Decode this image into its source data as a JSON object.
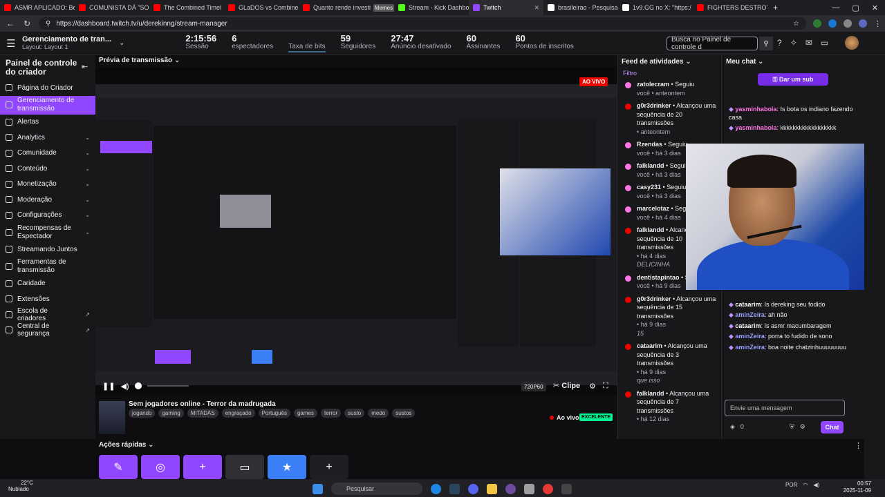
{
  "browser": {
    "tabs": [
      {
        "label": "ASMR APLICADO: Be",
        "color": "#ff0000"
      },
      {
        "label": "COMUNISTA DÁ \"SO",
        "color": "#ff0000"
      },
      {
        "label": "The Combined Timel",
        "color": "#ff0000"
      },
      {
        "label": "GLaDOS vs Combine",
        "color": "#ff0000"
      },
      {
        "label": "Quanto rende investi",
        "color": "#ff0000"
      },
      {
        "label": "Memes",
        "color": "#666666"
      },
      {
        "label": "Stream - Kick Dashbo",
        "color": "#53fc18"
      },
      {
        "label": "Twitch",
        "color": "#9146ff"
      },
      {
        "label": "brasileirao - Pesquisa",
        "color": "#ffffff"
      },
      {
        "label": "1v9.GG no X: \"https:/",
        "color": "#ffffff"
      },
      {
        "label": "FIGHTERS DESTROY C",
        "color": "#ff0000"
      }
    ],
    "url": "https://dashboard.twitch.tv/u/derekinng/stream-manager"
  },
  "topbar": {
    "context_title": "Gerenciamento de tran...",
    "context_sub": "Layout: Layout 1",
    "stats": [
      {
        "value": "2:15:56",
        "label": "Sessão"
      },
      {
        "value": "6",
        "label": "espectadores"
      },
      {
        "value": "",
        "label": "Taxa de bits"
      },
      {
        "value": "59",
        "label": "Seguidores"
      },
      {
        "value": "27:47",
        "label": "Anúncio desativado"
      },
      {
        "value": "60",
        "label": "Assinantes"
      },
      {
        "value": "60",
        "label": "Pontos de inscritos"
      }
    ],
    "search_placeholder": "Busca no Painel de controle d"
  },
  "sidebar": {
    "title": "Painel de controle do criador",
    "items": [
      {
        "label": "Página do Criador",
        "chevron": false
      },
      {
        "label": "Gerenciamento de transmissão",
        "chevron": false,
        "active": true
      },
      {
        "label": "Alertas",
        "chevron": false
      },
      {
        "label": "Analytics",
        "chevron": true
      },
      {
        "label": "Comunidade",
        "chevron": true
      },
      {
        "label": "Conteúdo",
        "chevron": true
      },
      {
        "label": "Monetização",
        "chevron": true
      },
      {
        "label": "Moderação",
        "chevron": true
      },
      {
        "label": "Configurações",
        "chevron": true
      },
      {
        "label": "Recompensas de Espectador",
        "chevron": true
      },
      {
        "label": "Streamando Juntos",
        "chevron": false
      },
      {
        "label": "Ferramentas de transmissão",
        "chevron": false
      },
      {
        "label": "Caridade",
        "chevron": false
      },
      {
        "label": "Extensões",
        "chevron": false
      },
      {
        "label": "Escola de criadores",
        "chevron": false
      },
      {
        "label": "Central de segurança",
        "chevron": false
      }
    ]
  },
  "preview": {
    "title": "Prévia de transmissão",
    "live_badge": "AO VIVO",
    "quality": "720P60",
    "clip": "Clipe"
  },
  "stream": {
    "title": "Sem jogadores online - Terror da madrugada",
    "tags": [
      "jogando",
      "gaming",
      "MITADAS",
      "engraçado",
      "Português",
      "games",
      "terror",
      "susto",
      "medo",
      "sustos"
    ],
    "live": "Ao vivo",
    "health": "EXCELENTE"
  },
  "quick_actions": {
    "title": "Ações rápidas"
  },
  "feed": {
    "title": "Feed de atividades",
    "filter": "Filtro",
    "entries": [
      {
        "name": "zatolecram",
        "action": " • Seguiu",
        "meta": "você • anteontem",
        "quote": "",
        "color": "#ff75e6"
      },
      {
        "name": "g0r3drinker",
        "action": " • Alcançou uma sequência de 20 transmissões",
        "meta": " • anteontem",
        "quote": "",
        "color": "#eb0400"
      },
      {
        "name": "Rzendas",
        "action": " • Seguiu",
        "meta": "você • há 3 dias",
        "quote": "",
        "color": "#ff75e6"
      },
      {
        "name": "falklandd",
        "action": " • Seguiu",
        "meta": "você • há 3 dias",
        "quote": "",
        "color": "#ff75e6"
      },
      {
        "name": "casy231",
        "action": " • Seguiu",
        "meta": "você • há 3 dias",
        "quote": "",
        "color": "#ff75e6"
      },
      {
        "name": "marcelotaz",
        "action": " • Seguiu",
        "meta": "você • há 4 dias",
        "quote": "",
        "color": "#ff75e6"
      },
      {
        "name": "falklandd",
        "action": " • Alcançou uma sequência de 10 transmissões",
        "meta": " • há 4 dias",
        "quote": "DELICINHA",
        "color": "#eb0400"
      },
      {
        "name": "dentistapintao",
        "action": " • Seguiu",
        "meta": "você • há 9 dias",
        "quote": "",
        "color": "#ff75e6"
      },
      {
        "name": "g0r3drinker",
        "action": " • Alcançou uma sequência de 15 transmissões",
        "meta": " • há 9 dias",
        "quote": "15",
        "color": "#eb0400"
      },
      {
        "name": "cataarim",
        "action": " • Alcançou uma sequência de 3 transmissões",
        "meta": " • há 9 dias",
        "quote": "que isso",
        "color": "#eb0400"
      },
      {
        "name": "falklandd",
        "action": " • Alcançou uma sequência de 7 transmissões",
        "meta": " • há 12 dias",
        "quote": "",
        "color": "#eb0400"
      }
    ]
  },
  "chat": {
    "title": "Meu chat",
    "sub_button": "Dar um sub",
    "messages": [
      {
        "user": "yasminhabola",
        "color": "#ff75e6",
        "text": ": Is bota os indiano fazendo casa"
      },
      {
        "user": "yasminhabola",
        "color": "#ff75e6",
        "text": ": kkkkkkkkkkkkkkkkkk"
      },
      {
        "user": "cataarim",
        "color": "#ffffff",
        "text": ": Is dereking seu fodido"
      },
      {
        "user": "aminZeira",
        "color": "#9aa0ff",
        "text": ": ah não"
      },
      {
        "user": "cataarim",
        "color": "#ffffff",
        "text": ": Is asmr macumbaragem"
      },
      {
        "user": "aminZeira",
        "color": "#9aa0ff",
        "text": ": porra to fudido de sono"
      },
      {
        "user": "aminZeira",
        "color": "#9aa0ff",
        "text": ": boa noite chatzinhuuuuuuuu"
      }
    ],
    "input_placeholder": "Envie uma mensagem",
    "points": "0",
    "chat_button": "Chat"
  },
  "taskbar": {
    "temp": "22°C",
    "weather": "Nublado",
    "search": "Pesquisar",
    "lang": "POR",
    "time": "00:57",
    "date": "2025-11-09"
  }
}
